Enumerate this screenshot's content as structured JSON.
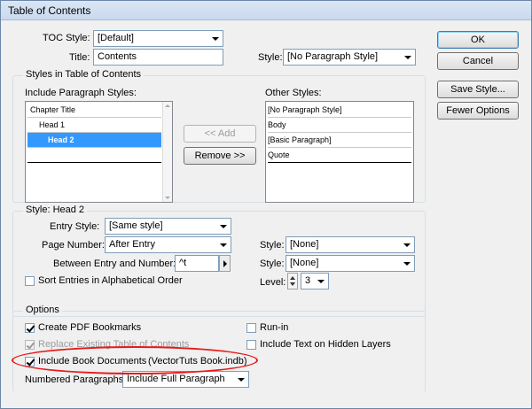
{
  "window": {
    "title": "Table of Contents"
  },
  "toc": {
    "toc_style_label": "TOC Style:",
    "toc_style_value": "[Default]",
    "title_label": "Title:",
    "title_value": "Contents",
    "style_label": "Style:",
    "style_value": "[No Paragraph Style]"
  },
  "buttons": {
    "ok": "OK",
    "cancel": "Cancel",
    "save_style": "Save Style...",
    "fewer_options": "Fewer Options",
    "add": "<< Add",
    "remove": "Remove >>"
  },
  "styles_group": {
    "title": "Styles in Table of Contents",
    "include_label": "Include Paragraph Styles:",
    "include_items": [
      {
        "label": "Chapter Title",
        "indent": 0,
        "selected": false
      },
      {
        "label": "Head 1",
        "indent": 1,
        "selected": false
      },
      {
        "label": "Head 2",
        "indent": 2,
        "selected": true
      }
    ],
    "other_label": "Other Styles:",
    "other_items": [
      "[No Paragraph Style]",
      "Body",
      "[Basic Paragraph]",
      "Quote"
    ]
  },
  "style_group": {
    "title": "Style: Head 2",
    "entry_style_label": "Entry Style:",
    "entry_style_value": "[Same style]",
    "page_number_label": "Page Number:",
    "page_number_value": "After Entry",
    "between_label": "Between Entry and Number:",
    "between_value": "^t",
    "style1_label": "Style:",
    "style1_value": "[None]",
    "style2_label": "Style:",
    "style2_value": "[None]",
    "sort_label": "Sort Entries in Alphabetical Order",
    "sort_checked": false,
    "level_label": "Level:",
    "level_value": "3"
  },
  "options_group": {
    "title": "Options",
    "create_pdf_label": "Create PDF Bookmarks",
    "create_pdf_checked": true,
    "replace_label": "Replace Existing Table of Contents",
    "replace_checked": true,
    "include_book_label": "Include Book Documents",
    "include_book_file": "(VectorTuts Book.indb)",
    "include_book_checked": true,
    "run_in_label": "Run-in",
    "run_in_checked": false,
    "hidden_layers_label": "Include Text on Hidden Layers",
    "hidden_layers_checked": false,
    "numbered_label": "Numbered Paragraphs:",
    "numbered_value": "Include Full Paragraph"
  },
  "colors": {
    "selection": "#3399ff",
    "highlight_ellipse": "#e81a1a",
    "accent_border": "#3c7fb1"
  }
}
